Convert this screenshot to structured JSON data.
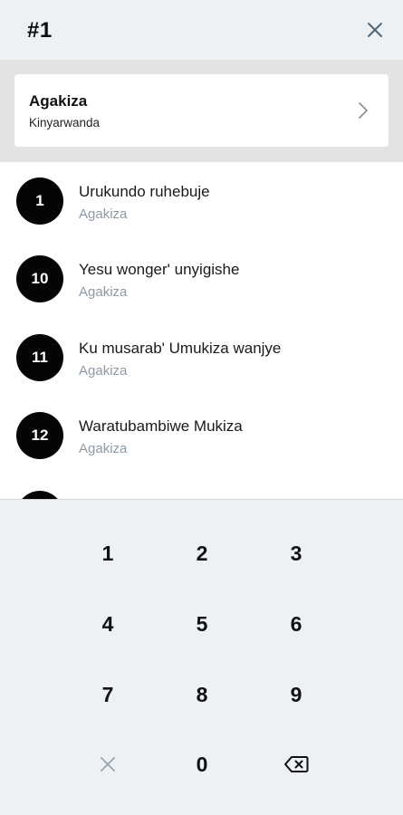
{
  "header": {
    "title": "#1",
    "close_icon": "close-icon"
  },
  "book": {
    "name": "Agakiza",
    "language": "Kinyarwanda",
    "chevron_icon": "chevron-right-icon"
  },
  "songs": [
    {
      "number": "1",
      "title": "Urukundo ruhebuje",
      "book": "Agakiza"
    },
    {
      "number": "10",
      "title": "Yesu wonger' unyigishe",
      "book": "Agakiza"
    },
    {
      "number": "11",
      "title": "Ku musarab' Umukiza wanjye",
      "book": "Agakiza"
    },
    {
      "number": "12",
      "title": "Waratubambiwe Mukiza",
      "book": "Agakiza"
    }
  ],
  "keypad": {
    "keys": [
      "1",
      "2",
      "3",
      "4",
      "5",
      "6",
      "7",
      "8",
      "9",
      "0"
    ],
    "clear_icon": "clear-x-icon",
    "backspace_icon": "backspace-icon"
  },
  "colors": {
    "background": "#eef1f4",
    "badge": "#050505",
    "subtitle": "#8d9aa6",
    "band": "#e3e3e3"
  }
}
